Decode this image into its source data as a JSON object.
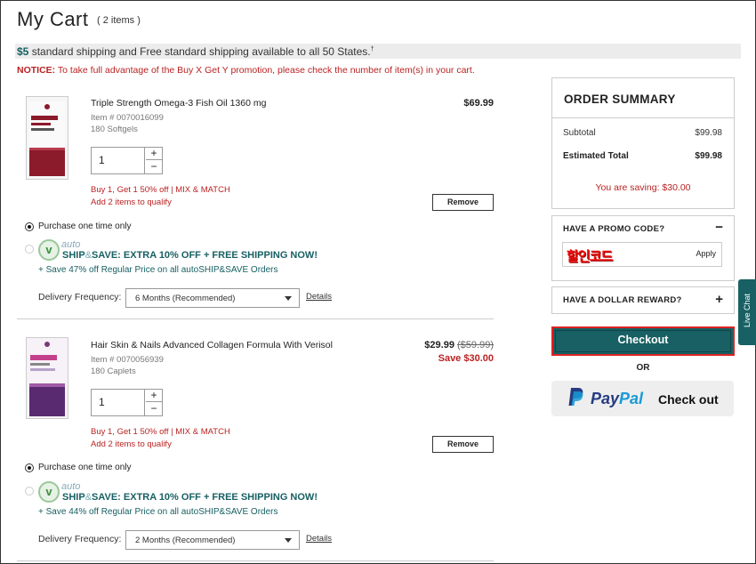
{
  "page": {
    "title": "My Cart",
    "item_count": "( 2 items )"
  },
  "shipping_banner": {
    "dollar": "$5",
    "text": " standard shipping and Free standard shipping available to all 50 States.",
    "mark": "†"
  },
  "notice": {
    "label": "NOTICE:",
    "text": " To take full advantage of the Buy X Get Y promotion, please check the number of item(s) in your cart."
  },
  "items": [
    {
      "name": "Triple Strength Omega-3 Fish Oil 1360 mg",
      "item_no": "Item # 0070016099",
      "size": "180 Softgels",
      "price": "$69.99",
      "original_price": "",
      "save": "",
      "qty": "1",
      "promo_line1": "Buy 1, Get 1 50% off | MIX & MATCH",
      "promo_line2": "Add 2 items to qualify",
      "remove_label": "Remove",
      "onetime_label": "Purchase one time only",
      "ss_auto": "auto",
      "ss_headline_a": "SHIP",
      "ss_headline_amp": "&",
      "ss_headline_b": "SAVE: EXTRA 10% OFF + FREE SHIPPING NOW!",
      "ss_sub": "+ Save 47% off Regular Price on all autoSHIP&SAVE Orders",
      "freq_label": "Delivery Frequency:",
      "freq_value": "6 Months (Recommended)",
      "details_label": "Details"
    },
    {
      "name": "Hair Skin & Nails Advanced Collagen Formula With Verisol",
      "item_no": "Item # 0070056939",
      "size": "180 Caplets",
      "price": "$29.99",
      "original_price": "($59.99)",
      "save": "Save $30.00",
      "qty": "1",
      "promo_line1": "Buy 1, Get 1 50% off | MIX & MATCH",
      "promo_line2": "Add 2 items to qualify",
      "remove_label": "Remove",
      "onetime_label": "Purchase one time only",
      "ss_auto": "auto",
      "ss_headline_a": "SHIP",
      "ss_headline_amp": "&",
      "ss_headline_b": "SAVE: EXTRA 10% OFF + FREE SHIPPING NOW!",
      "ss_sub": "+ Save 44% off Regular Price on all autoSHIP&SAVE Orders",
      "freq_label": "Delivery Frequency:",
      "freq_value": "2 Months (Recommended)",
      "details_label": "Details"
    }
  ],
  "summary": {
    "title": "ORDER SUMMARY",
    "subtotal_label": "Subtotal",
    "subtotal_value": "$99.98",
    "est_label": "Estimated Total",
    "est_value": "$99.98",
    "saving": "You are saving: $30.00"
  },
  "promo": {
    "title": "HAVE A PROMO CODE?",
    "toggle": "−",
    "coupon_text": "할인코드",
    "apply": "Apply"
  },
  "reward": {
    "title": "HAVE A DOLLAR REWARD?",
    "toggle": "+"
  },
  "checkout": {
    "label": "Checkout",
    "or": "OR"
  },
  "paypal": {
    "pay": "Pay",
    "pal": "Pal",
    "check": "Check out"
  },
  "livechat": {
    "label": "Live Chat"
  },
  "colors": {
    "teal": "#186063",
    "red": "#bb2222",
    "checkout_border": "#dd2222"
  }
}
